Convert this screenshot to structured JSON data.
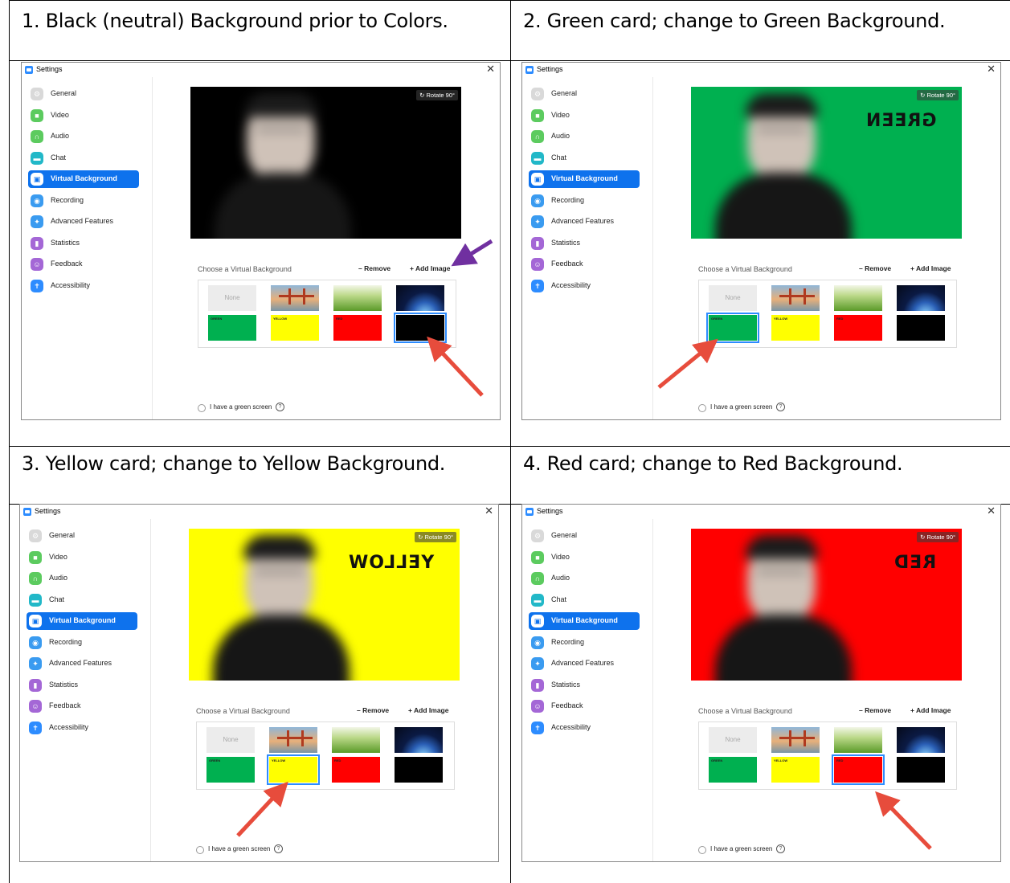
{
  "cells": [
    {
      "caption": "1. Black (neutral) Background prior to Colors.",
      "preview_color": "#000000",
      "mirror_word": "",
      "selected": 7
    },
    {
      "caption": "2. Green card; change to Green Background.",
      "preview_color": "#00b050",
      "mirror_word": "GREEN",
      "selected": 4
    },
    {
      "caption": "3. Yellow card; change to Yellow Background.",
      "preview_color": "#ffff00",
      "mirror_word": "YELLOW",
      "selected": 5
    },
    {
      "caption": "4. Red card; change to Red Background.",
      "preview_color": "#ff0000",
      "mirror_word": "RED",
      "selected": 6
    }
  ],
  "window": {
    "title": "Settings",
    "close": "✕",
    "rotate": "↻ Rotate 90°",
    "choose_label": "Choose a Virtual Background",
    "remove_label": "– Remove",
    "add_label": "+ Add Image",
    "green_screen_label": "I have a green screen",
    "help_glyph": "?",
    "sidebar": [
      {
        "label": "General",
        "icon": "gear-icon",
        "color": "#d9d9d9",
        "glyph": "⚙"
      },
      {
        "label": "Video",
        "icon": "camera-icon",
        "color": "#5ccb5f",
        "glyph": "■"
      },
      {
        "label": "Audio",
        "icon": "headphones-icon",
        "color": "#5ccb5f",
        "glyph": "∩"
      },
      {
        "label": "Chat",
        "icon": "chat-icon",
        "color": "#22b8c8",
        "glyph": "▬"
      },
      {
        "label": "Virtual Background",
        "icon": "person-icon",
        "color": "#0e72ed",
        "glyph": "▣"
      },
      {
        "label": "Recording",
        "icon": "record-icon",
        "color": "#3a9bf0",
        "glyph": "◉"
      },
      {
        "label": "Advanced Features",
        "icon": "sparkle-icon",
        "color": "#3a9bf0",
        "glyph": "✦"
      },
      {
        "label": "Statistics",
        "icon": "bar-chart-icon",
        "color": "#a467d6",
        "glyph": "▮"
      },
      {
        "label": "Feedback",
        "icon": "smile-icon",
        "color": "#a467d6",
        "glyph": "☺"
      },
      {
        "label": "Accessibility",
        "icon": "accessibility-icon",
        "color": "#2d8cff",
        "glyph": "✝"
      }
    ],
    "thumbnails": [
      {
        "kind": "none",
        "label": "None"
      },
      {
        "kind": "bridge",
        "label": ""
      },
      {
        "kind": "grass",
        "label": ""
      },
      {
        "kind": "earth",
        "label": ""
      },
      {
        "kind": "color",
        "label": "GREEN",
        "color": "#00b050"
      },
      {
        "kind": "color",
        "label": "YELLOW",
        "color": "#ffff00"
      },
      {
        "kind": "color",
        "label": "RED",
        "color": "#ff0000"
      },
      {
        "kind": "color",
        "label": "",
        "color": "#000000"
      }
    ]
  },
  "arrow_colors": {
    "red": "#e74c3c",
    "purple": "#7030a0"
  }
}
